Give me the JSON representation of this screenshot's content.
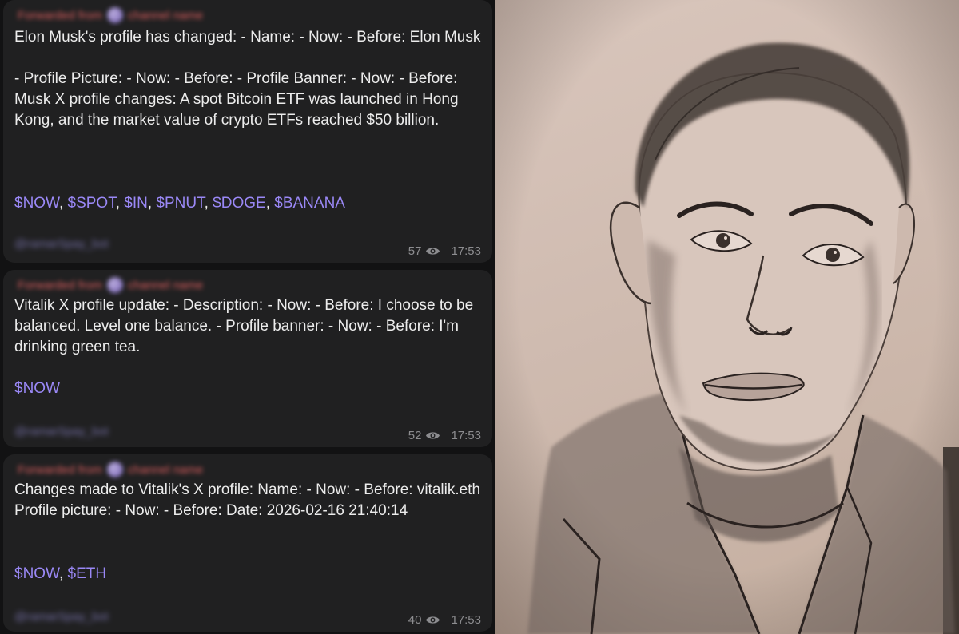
{
  "messages": [
    {
      "forwarded": "Forwarded from",
      "text": "Elon Musk's profile has changed: - Name: - Now: - Before: Elon Musk\n\n- Profile Picture: - Now: - Before: - Profile Banner: - Now: - Before: Musk X profile changes: A spot Bitcoin ETF was launched in Hong Kong, and the market value of crypto ETFs reached $50 billion.",
      "tickers": [
        "$NOW",
        "$SPOT",
        "$IN",
        "$PNUT",
        "$DOGE",
        "$BANANA"
      ],
      "signature": "@ramarSpay_bot",
      "views": "57",
      "time": "17:53"
    },
    {
      "forwarded": "Forwarded from",
      "text": "Vitalik X profile update: - Description: - Now: - Before: I choose to be balanced. Level one balance. - Profile banner: - Now: - Before: I'm drinking green tea.",
      "tickers": [
        "$NOW"
      ],
      "signature": "@ramarSpay_bot",
      "views": "52",
      "time": "17:53"
    },
    {
      "forwarded": "Forwarded from",
      "text": "Changes made to Vitalik's X profile: Name: - Now: - Before: vitalik.eth Profile picture: - Now: - Before: Date: 2026-02-16 21:40:14",
      "tickers": [
        "$NOW",
        "$ETH"
      ],
      "signature": "@ramarSpay_bot",
      "views": "40",
      "time": "17:53"
    }
  ],
  "colors": {
    "bubble": "#202021",
    "ticker": "#9a88f6",
    "meta": "#8c8c8f",
    "paper": "#d4c0b5"
  },
  "icons": {
    "views": "eye-icon"
  }
}
